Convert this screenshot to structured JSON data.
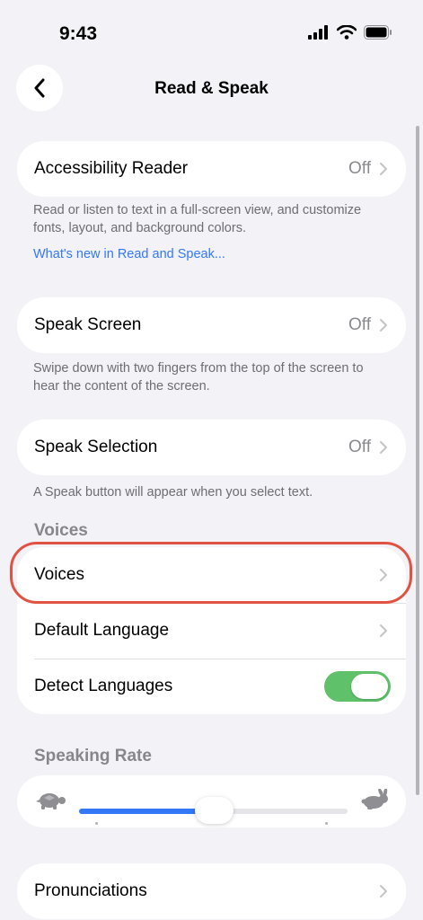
{
  "status_bar": {
    "time": "9:43"
  },
  "nav": {
    "title": "Read & Speak"
  },
  "accessibility_reader": {
    "label": "Accessibility Reader",
    "value": "Off",
    "footnote": "Read or listen to text in a full-screen view, and customize fonts, layout, and background colors.",
    "link": "What's new in Read and Speak..."
  },
  "speak_screen": {
    "label": "Speak Screen",
    "value": "Off",
    "footnote": "Swipe down with two fingers from the top of the screen to hear the content of the screen."
  },
  "speak_selection": {
    "label": "Speak Selection",
    "value": "Off",
    "footnote": "A Speak button will appear when you select text."
  },
  "voices_section": {
    "header": "Voices",
    "voices_label": "Voices",
    "default_language_label": "Default Language",
    "detect_languages_label": "Detect Languages",
    "detect_languages_on": true
  },
  "speaking_rate": {
    "header": "Speaking Rate",
    "value_fraction": 0.5
  },
  "pronunciations": {
    "label": "Pronunciations"
  },
  "colors": {
    "accent": "#3478f6",
    "toggle_on": "#5fc26a",
    "highlight": "#e05242"
  },
  "icons": [
    "back-chevron-icon",
    "cellular-signal-icon",
    "wifi-icon",
    "battery-icon",
    "chevron-right-icon",
    "turtle-icon",
    "rabbit-icon"
  ]
}
